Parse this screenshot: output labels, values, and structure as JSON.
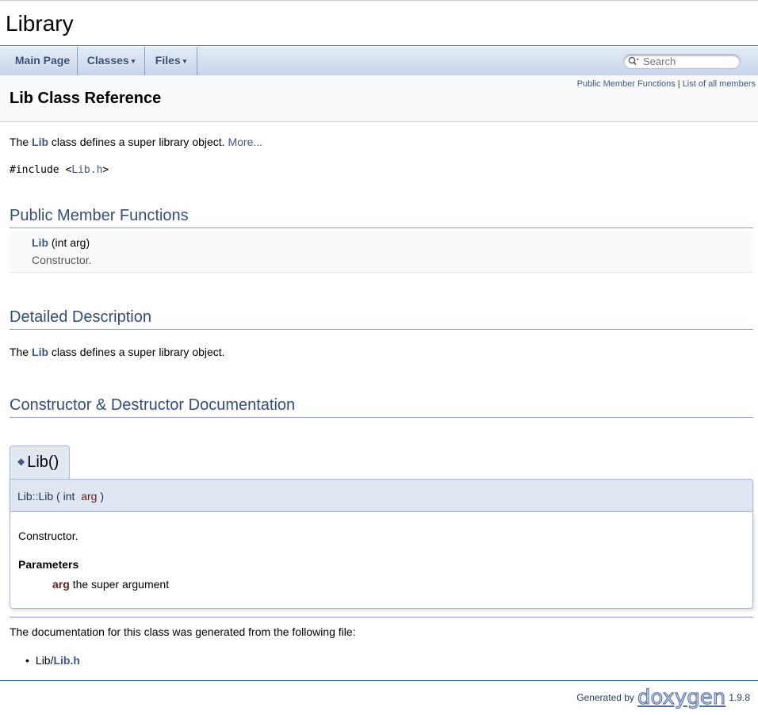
{
  "project": {
    "name": "Library"
  },
  "nav": {
    "main_page": "Main Page",
    "classes": "Classes",
    "files": "Files",
    "caret": "▾"
  },
  "search": {
    "placeholder": "Search",
    "icon": "search-icon"
  },
  "header": {
    "summary_public": "Public Member Functions",
    "summary_sep": "|",
    "summary_all": "List of all members",
    "title": "Lib Class Reference"
  },
  "brief": {
    "prefix": "The",
    "class_link": "Lib",
    "text": "class defines a super library object.",
    "more": "More..."
  },
  "include": {
    "directive": "#include <",
    "file": "Lib.h",
    "close": ">"
  },
  "sections": {
    "public_members": "Public Member Functions",
    "detailed": "Detailed Description",
    "ctor": "Constructor & Destructor Documentation"
  },
  "member": {
    "name": "Lib",
    "args": "(int arg)",
    "brief": "Constructor."
  },
  "detailed": {
    "prefix": "The",
    "class_link": "Lib",
    "text": "class defines a super library object."
  },
  "memdoc": {
    "diamond": "◆",
    "title": "Lib()",
    "proto_name": "Lib::Lib",
    "proto_open": "(",
    "proto_type": "int",
    "proto_param": "arg",
    "proto_close": ")",
    "description": "Constructor.",
    "params_heading": "Parameters",
    "param_name": "arg",
    "param_desc": "the super argument"
  },
  "generated": {
    "text": "The documentation for this class was generated from the following file:",
    "file_dir": "Lib/",
    "file_link": "Lib.h"
  },
  "footer": {
    "generated_by": "Generated by",
    "logo": "doxygen",
    "version": "1.9.8"
  }
}
